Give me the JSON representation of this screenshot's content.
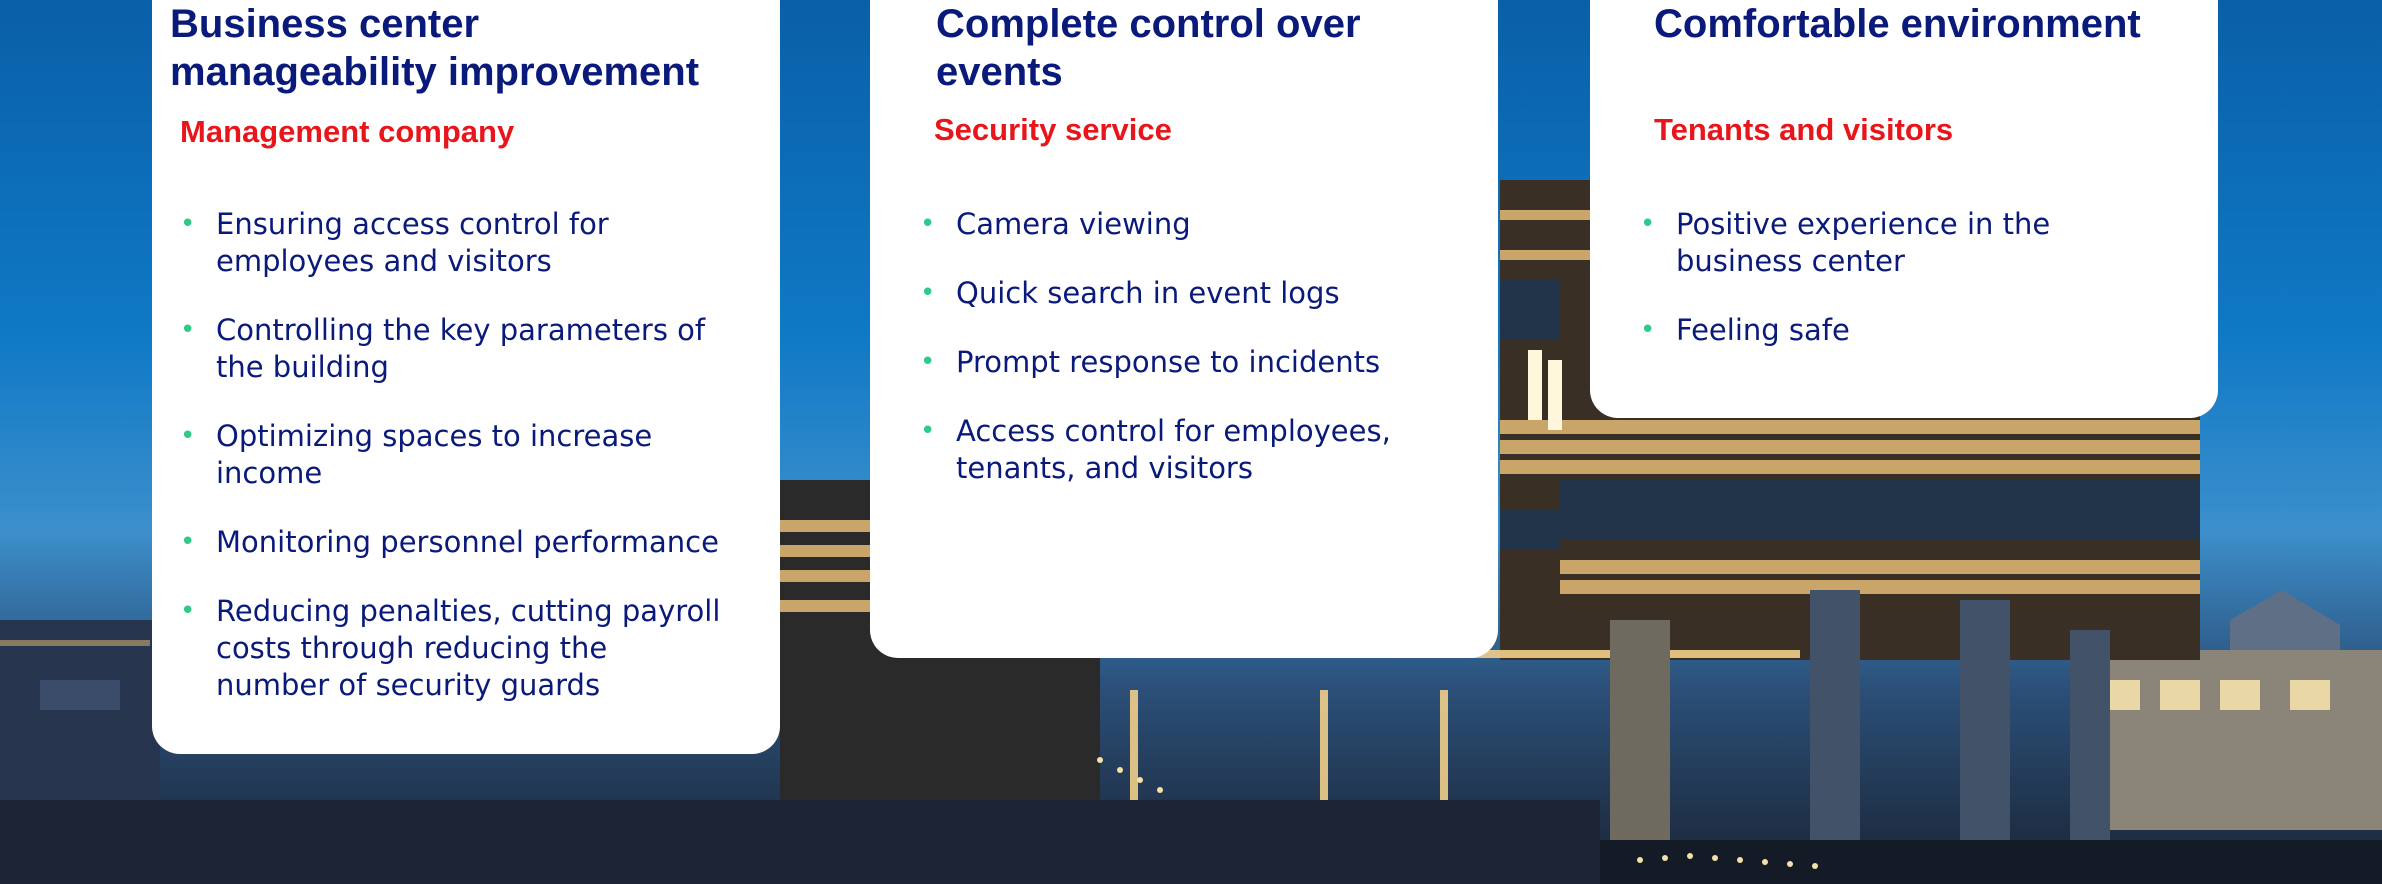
{
  "cards": [
    {
      "title_lines": [
        "Business center",
        "manageability improvement"
      ],
      "subtitle": "Management company",
      "items": [
        [
          "Ensuring access control for",
          "employees and visitors"
        ],
        [
          "Controlling the key parameters of",
          "the building"
        ],
        [
          "Optimizing spaces to increase",
          "income"
        ],
        [
          "Monitoring personnel performance"
        ],
        [
          "Reducing penalties, cutting payroll",
          "costs through reducing the",
          "number of security guards"
        ]
      ]
    },
    {
      "title_lines": [
        "Complete control over",
        "events"
      ],
      "subtitle": "Security service",
      "items": [
        [
          "Camera viewing"
        ],
        [
          "Quick search in event logs"
        ],
        [
          "Prompt response to incidents"
        ],
        [
          "Access control for employees,",
          "tenants, and visitors"
        ]
      ]
    },
    {
      "title_lines": [
        "Comfortable environment"
      ],
      "subtitle": "Tenants and visitors",
      "items": [
        [
          "Positive experience in the",
          "business center"
        ],
        [
          "Feeling safe"
        ]
      ]
    }
  ],
  "colors": {
    "title": "#0a1a7a",
    "subtitle": "#e8161b",
    "bullet": "#2fc98a",
    "card": "#ffffff"
  },
  "bullet_glyph": "•"
}
